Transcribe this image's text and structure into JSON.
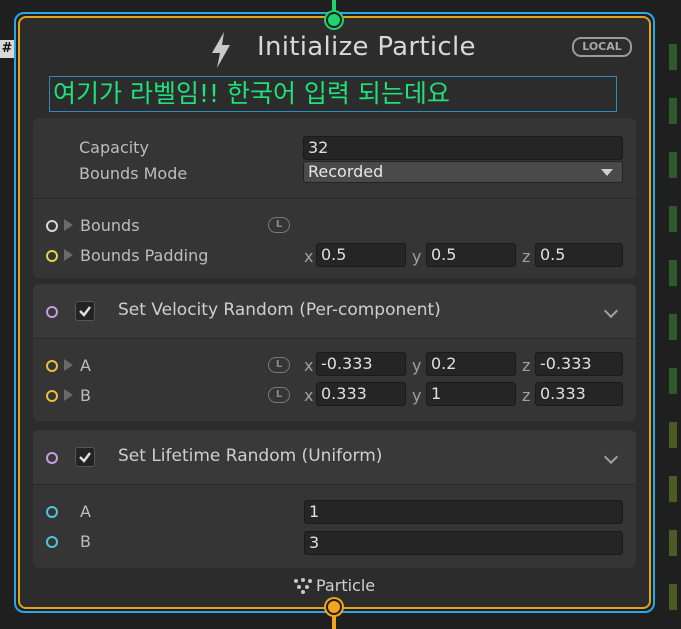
{
  "node": {
    "title": "Initialize Particle",
    "space_badge": "LOCAL",
    "label": "여기가 라벨임!! 한국어 입력 되는데요",
    "footer": "Particle",
    "title_icon": "lightning-icon",
    "footer_icon": "particle-system-icon",
    "colors": {
      "selection": "#2aa7e6",
      "border": "#e3a21a",
      "flow_in": "#1fd36e",
      "flow_out": "#f2a61e"
    }
  },
  "settings": {
    "capacity_label": "Capacity",
    "capacity_value": "32",
    "bounds_mode_label": "Bounds Mode",
    "bounds_mode_value": "Recorded",
    "bounds_label": "Bounds",
    "bounds_padding_label": "Bounds Padding",
    "bounds_padding": {
      "x_label": "x",
      "x": "0.5",
      "y_label": "y",
      "y": "0.5",
      "z_label": "z",
      "z": "0.5"
    },
    "local_badge": "L"
  },
  "block_velocity": {
    "title": "Set Velocity Random (Per-component)",
    "checked": true,
    "a_label": "A",
    "a": {
      "x_label": "x",
      "x": "-0.333",
      "y_label": "y",
      "y": "0.2",
      "z_label": "z",
      "z": "-0.333"
    },
    "b_label": "B",
    "b": {
      "x_label": "x",
      "x": "0.333",
      "y_label": "y",
      "y": "1",
      "z_label": "z",
      "z": "0.333"
    },
    "local_badge": "L"
  },
  "block_lifetime": {
    "title": "Set Lifetime Random (Uniform)",
    "checked": true,
    "a_label": "A",
    "a_value": "1",
    "b_label": "B",
    "b_value": "3"
  },
  "side": {
    "hash": "#"
  }
}
